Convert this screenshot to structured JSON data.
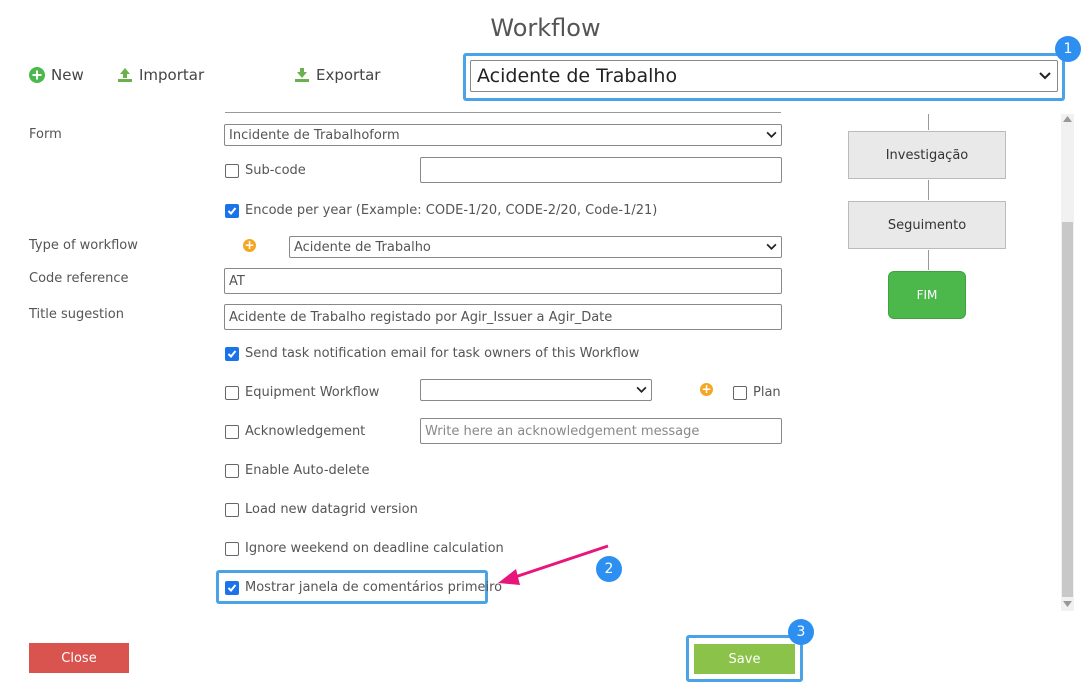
{
  "dialog": {
    "title": "Workflow"
  },
  "toolbar": {
    "new_label": "New",
    "import_label": "Importar",
    "export_label": "Exportar"
  },
  "workflow_select": {
    "value": "Acidente de Trabalho"
  },
  "badges": [
    "1",
    "2",
    "3"
  ],
  "form": {
    "form_label": "Form",
    "form_value": "Incidente de Trabalhoform",
    "subcode_label": "Sub-code",
    "subcode_checked": false,
    "subcode_value": "",
    "encode_label": "Encode per year (Example: CODE-1/20, CODE-2/20, Code-1/21)",
    "encode_checked": true,
    "type_label": "Type of workflow",
    "type_value": "Acidente de Trabalho",
    "code_label": "Code reference",
    "code_value": "AT",
    "title_label": "Title sugestion",
    "title_value": "Acidente de Trabalho registado por Agir_Issuer a Agir_Date",
    "send_label": "Send task notification email for task owners of this Workflow",
    "send_checked": true,
    "equipment_label": "Equipment Workflow",
    "equipment_checked": false,
    "equipment_value": "",
    "plan_label": "Plan",
    "plan_checked": false,
    "ack_label": "Acknowledgement",
    "ack_checked": false,
    "ack_placeholder": "Write here an acknowledgement message",
    "autodelete_label": "Enable Auto-delete",
    "autodelete_checked": false,
    "datagrid_label": "Load new datagrid version",
    "datagrid_checked": false,
    "weekend_label": "Ignore weekend on deadline calculation",
    "weekend_checked": false,
    "comments_label": "Mostrar janela de comentários primeiro",
    "comments_checked": true
  },
  "diagram": {
    "nodes": [
      "Investigação",
      "Seguimento"
    ],
    "end_node": "FIM"
  },
  "footer": {
    "close_label": "Close",
    "save_label": "Save"
  },
  "colors": {
    "accent": "#2d8ff0",
    "close": "#d9534f",
    "save": "#8bc34a",
    "end_node": "#4cb84c",
    "arrow": "#e8157a"
  },
  "icons": [
    "plus-circle-icon",
    "upload-icon",
    "download-icon",
    "chevron-down-icon",
    "add-icon",
    "arrow-icon",
    "check-icon"
  ]
}
